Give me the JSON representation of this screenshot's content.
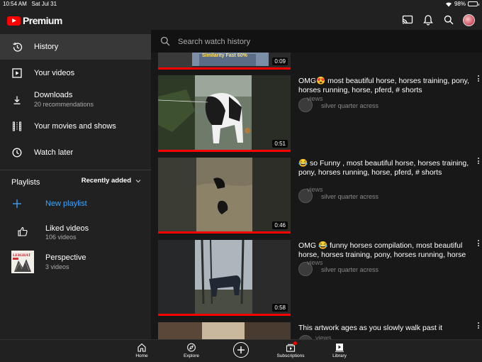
{
  "status_bar": {
    "time": "10:54 AM",
    "date": "Sat Jul 31",
    "battery": "98%",
    "battery_level": 0.98
  },
  "app": {
    "brand": "Premium"
  },
  "sidebar": {
    "items": [
      {
        "label": "History",
        "icon": "history-icon",
        "active": true
      },
      {
        "label": "Your videos",
        "icon": "play-icon"
      },
      {
        "label": "Downloads",
        "sub": "20 recommendations",
        "icon": "download-icon"
      },
      {
        "label": "Your movies and shows",
        "icon": "film-icon"
      },
      {
        "label": "Watch later",
        "icon": "clock-icon"
      }
    ],
    "playlists_heading": "Playlists",
    "sort_label": "Recently added",
    "new_playlist": "New playlist",
    "playlists": [
      {
        "title": "Liked videos",
        "count": "106 videos"
      },
      {
        "title": "Perspective",
        "count": "3 videos",
        "thumb_text": "LEIGHAT"
      }
    ]
  },
  "search": {
    "placeholder": "Search watch history"
  },
  "videos": [
    {
      "duration": "0:09",
      "thumb_overlay": "Similarity Fast 60%"
    },
    {
      "title": "OMG😍 most beautiful horse, horses training, pony, horses running, horse, pferd, # shorts",
      "views": "views",
      "channel": "silver quarter acress",
      "duration": "0:51"
    },
    {
      "title": "😂 so Funny , most beautiful horse, horses training, pony, horses running, horse, pferd, # shorts",
      "views": "views",
      "channel": "silver quarter acress",
      "duration": "0:46"
    },
    {
      "title": "OMG 😂 funny horses compilation, most beautiful horse, horses training, pony, horses running, horse",
      "views": "views",
      "channel": "silver quarter acress",
      "duration": "0:58"
    },
    {
      "title": "This artwork ages as you slowly walk past it",
      "views": "views"
    }
  ],
  "bottom_nav": {
    "home": "Home",
    "explore": "Explore",
    "subscriptions": "Subscriptions",
    "library": "Library"
  },
  "colors": {
    "accent": "#ff0000",
    "link": "#3ea6ff",
    "background": "#181818",
    "surface": "#212121"
  }
}
